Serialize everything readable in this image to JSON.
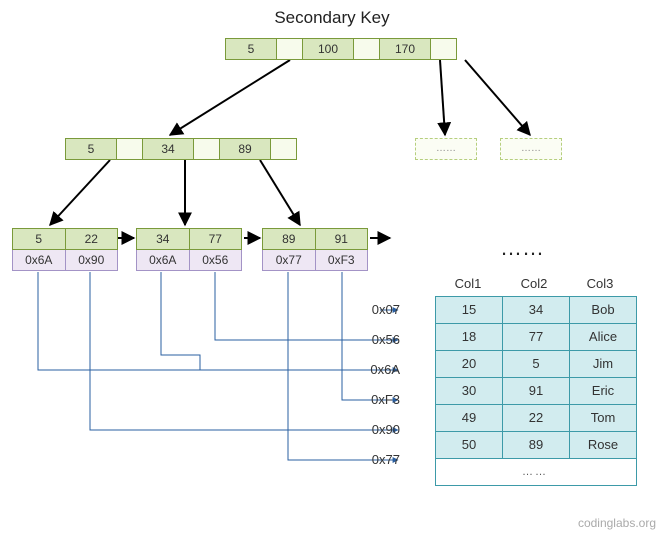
{
  "title": "Secondary Key",
  "root": {
    "keys": [
      "5",
      "100",
      "170"
    ]
  },
  "level1": {
    "keys": [
      "5",
      "34",
      "89"
    ]
  },
  "level1_extra": {
    "ell": "……"
  },
  "leaves": [
    {
      "keys": [
        "5",
        "22"
      ],
      "ptrs": [
        "0x6A",
        "0x90"
      ]
    },
    {
      "keys": [
        "34",
        "77"
      ],
      "ptrs": [
        "0x6A",
        "0x56"
      ]
    },
    {
      "keys": [
        "89",
        "91"
      ],
      "ptrs": [
        "0x77",
        "0xF3"
      ]
    }
  ],
  "leaf_ell": "……",
  "addresses": [
    "0x07",
    "0x56",
    "0x6A",
    "0xF3",
    "0x90",
    "0x77"
  ],
  "table": {
    "headers": [
      "Col1",
      "Col2",
      "Col3"
    ],
    "rows": [
      [
        "15",
        "34",
        "Bob"
      ],
      [
        "18",
        "77",
        "Alice"
      ],
      [
        "20",
        "5",
        "Jim"
      ],
      [
        "30",
        "91",
        "Eric"
      ],
      [
        "49",
        "22",
        "Tom"
      ],
      [
        "50",
        "89",
        "Rose"
      ]
    ],
    "more": "……"
  },
  "credit": "codinglabs.org"
}
